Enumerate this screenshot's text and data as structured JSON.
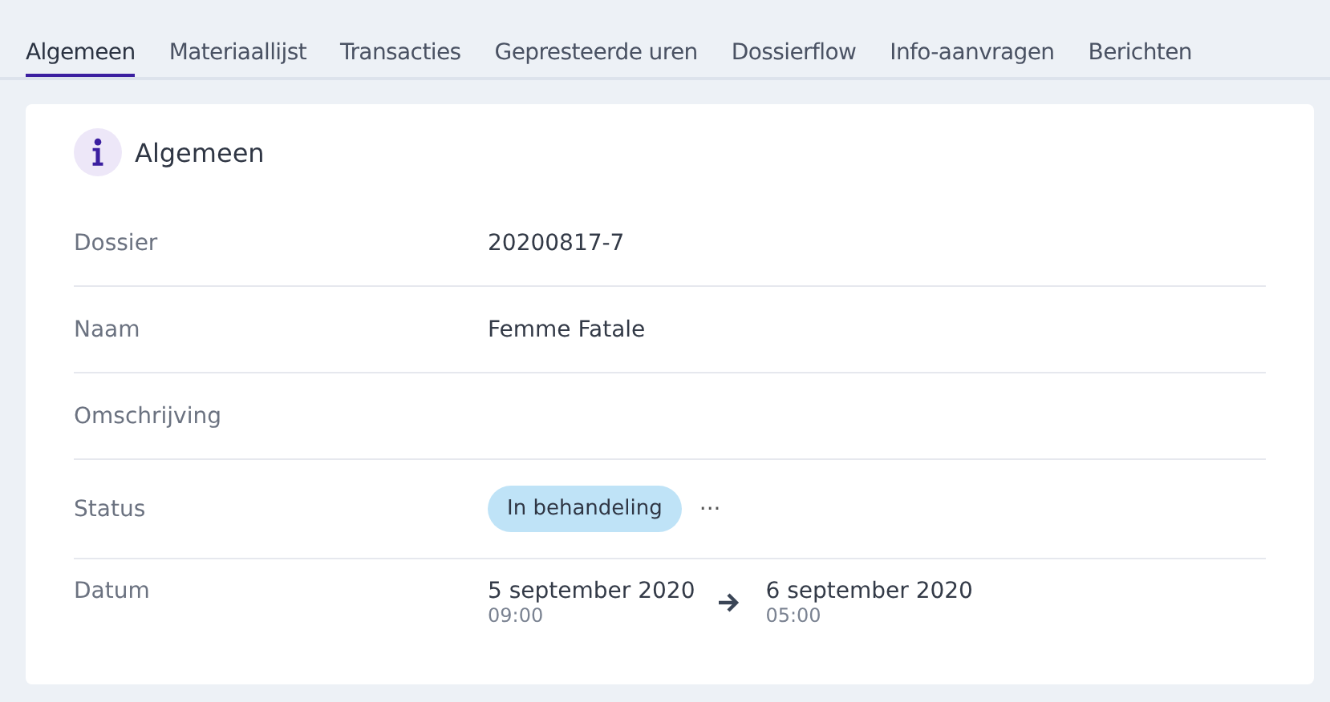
{
  "tabs": [
    {
      "label": "Algemeen",
      "selected": true
    },
    {
      "label": "Materiaallijst",
      "selected": false
    },
    {
      "label": "Transacties",
      "selected": false
    },
    {
      "label": "Gepresteerde uren",
      "selected": false
    },
    {
      "label": "Dossierflow",
      "selected": false
    },
    {
      "label": "Info-aanvragen",
      "selected": false
    },
    {
      "label": "Berichten",
      "selected": false
    }
  ],
  "card": {
    "title": "Algemeen",
    "rows": [
      {
        "kind": "text",
        "label": "Dossier",
        "value": "20200817-7"
      },
      {
        "kind": "text",
        "label": "Naam",
        "value": "Femme Fatale"
      },
      {
        "kind": "empty",
        "label": "Omschrijving"
      },
      {
        "kind": "status",
        "label": "Status",
        "status": "In behandeling",
        "more": "···"
      },
      {
        "kind": "daterange",
        "label": "Datum",
        "start_date": "5 september 2020",
        "start_time": "09:00",
        "end_date": "6 september 2020",
        "end_time": "05:00"
      }
    ]
  }
}
